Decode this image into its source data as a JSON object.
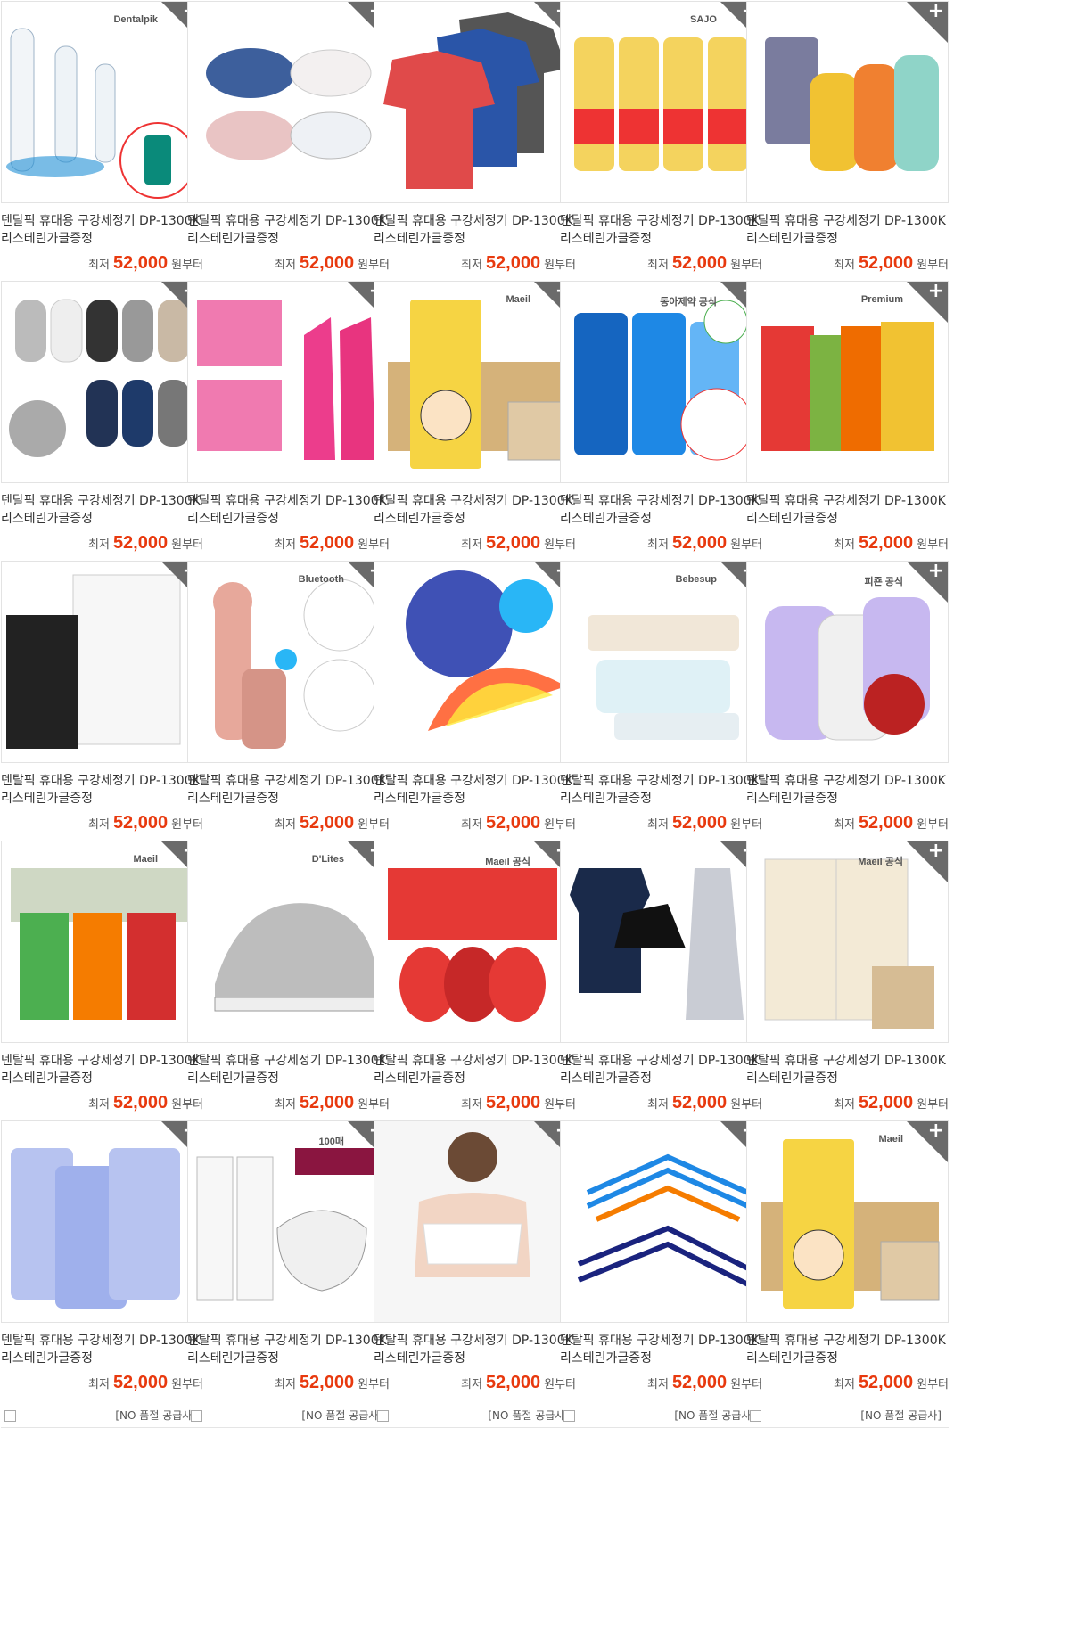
{
  "products": [
    {
      "title_line1": "덴탈픽 휴대용 구강세정기 DP-1300K",
      "title_line2": "리스테린가글증정",
      "price_prefix": "최저",
      "price": "52,000",
      "price_suffix": "원부터",
      "supplier": "[NO 품절 공급사]",
      "icon": "water-flosser-image",
      "badge": "Dentalpik",
      "add_label": "+"
    },
    {
      "title_line1": "덴탈픽 휴대용 구강세정기 DP-1300K",
      "title_line2": "리스테린가글증정",
      "price_prefix": "최저",
      "price": "52,000",
      "price_suffix": "원부터",
      "supplier": "[NO 품절 공급사]",
      "icon": "kids-shoes-image",
      "badge": "",
      "add_label": "+"
    },
    {
      "title_line1": "덴탈픽 휴대용 구강세정기 DP-1300K",
      "title_line2": "리스테린가글증정",
      "price_prefix": "최저",
      "price": "52,000",
      "price_suffix": "원부터",
      "supplier": "[NO 품절 공급사]",
      "icon": "tshirts-image",
      "badge": "",
      "add_label": "+"
    },
    {
      "title_line1": "덴탈픽 휴대용 구강세정기 DP-1300K",
      "title_line2": "리스테린가글증정",
      "price_prefix": "최저",
      "price": "52,000",
      "price_suffix": "원부터",
      "supplier": "[NO 품절 공급사]",
      "icon": "cooking-oil-image",
      "badge": "SAJO",
      "add_label": "+"
    },
    {
      "title_line1": "덴탈픽 휴대용 구강세정기 DP-1300K",
      "title_line2": "리스테린가글증정",
      "price_prefix": "최저",
      "price": "52,000",
      "price_suffix": "원부터",
      "supplier": "[NO 품절 공급사]",
      "icon": "detergent-image",
      "badge": "",
      "add_label": "+"
    },
    {
      "title_line1": "덴탈픽 휴대용 구강세정기 DP-1300K",
      "title_line2": "리스테린가글증정",
      "price_prefix": "최저",
      "price": "52,000",
      "price_suffix": "원부터",
      "supplier": "[NO 품절 공급사]",
      "icon": "socks-image",
      "badge": "",
      "add_label": "+"
    },
    {
      "title_line1": "덴탈픽 휴대용 구강세정기 DP-1300K",
      "title_line2": "리스테린가글증정",
      "price_prefix": "최저",
      "price": "52,000",
      "price_suffix": "원부터",
      "supplier": "[NO 품절 공급사]",
      "icon": "rubber-gloves-image",
      "badge": "",
      "add_label": "+"
    },
    {
      "title_line1": "덴탈픽 휴대용 구강세정기 DP-1300K",
      "title_line2": "리스테린가글증정",
      "price_prefix": "최저",
      "price": "52,000",
      "price_suffix": "원부터",
      "supplier": "[NO 품절 공급사]",
      "icon": "banana-milk-image",
      "badge": "Maeil",
      "add_label": "+"
    },
    {
      "title_line1": "덴탈픽 휴대용 구강세정기 DP-1300K",
      "title_line2": "리스테린가글증정",
      "price_prefix": "최저",
      "price": "52,000",
      "price_suffix": "원부터",
      "supplier": "[NO 품절 공급사]",
      "icon": "mouthwash-image",
      "badge": "동아제약 공식",
      "add_label": "+"
    },
    {
      "title_line1": "덴탈픽 휴대용 구강세정기 DP-1300K",
      "title_line2": "리스테린가글증정",
      "price_prefix": "최저",
      "price": "52,000",
      "price_suffix": "원부터",
      "supplier": "[NO 품절 공급사]",
      "icon": "supplement-pouch-image",
      "badge": "Premium",
      "add_label": "+"
    },
    {
      "title_line1": "덴탈픽 휴대용 구강세정기 DP-1300K",
      "title_line2": "리스테린가글증정",
      "price_prefix": "최저",
      "price": "52,000",
      "price_suffix": "원부터",
      "supplier": "[NO 품절 공급사]",
      "icon": "air-purifier-image",
      "badge": "",
      "add_label": "+"
    },
    {
      "title_line1": "덴탈픽 휴대용 구강세정기 DP-1300K",
      "title_line2": "리스테린가글증정",
      "price_prefix": "최저",
      "price": "52,000",
      "price_suffix": "원부터",
      "supplier": "[NO 품절 공급사]",
      "icon": "karaoke-mic-image",
      "badge": "Bluetooth",
      "add_label": "+"
    },
    {
      "title_line1": "덴탈픽 휴대용 구강세정기 DP-1300K",
      "title_line2": "리스테린가글증정",
      "price_prefix": "최저",
      "price": "52,000",
      "price_suffix": "원부터",
      "supplier": "[NO 품절 공급사]",
      "icon": "umbrella-image",
      "badge": "",
      "add_label": "+"
    },
    {
      "title_line1": "덴탈픽 휴대용 구강세정기 DP-1300K",
      "title_line2": "리스테린가글증정",
      "price_prefix": "최저",
      "price": "52,000",
      "price_suffix": "원부터",
      "supplier": "[NO 품절 공급사]",
      "icon": "wet-wipes-image",
      "badge": "Bebesup",
      "add_label": "+"
    },
    {
      "title_line1": "덴탈픽 휴대용 구강세정기 DP-1300K",
      "title_line2": "리스테린가글증정",
      "price_prefix": "최저",
      "price": "52,000",
      "price_suffix": "원부터",
      "supplier": "[NO 품절 공급사]",
      "icon": "fabric-softener-image",
      "badge": "피죤 공식",
      "add_label": "+"
    },
    {
      "title_line1": "덴탈픽 휴대용 구강세정기 DP-1300K",
      "title_line2": "리스테린가글증정",
      "price_prefix": "최저",
      "price": "52,000",
      "price_suffix": "원부터",
      "supplier": "[NO 품절 공급사]",
      "icon": "juice-box-image",
      "badge": "Maeil",
      "add_label": "+"
    },
    {
      "title_line1": "덴탈픽 휴대용 구강세정기 DP-1300K",
      "title_line2": "리스테린가글증정",
      "price_prefix": "최저",
      "price": "52,000",
      "price_suffix": "원부터",
      "supplier": "[NO 품절 공급사]",
      "icon": "sneakers-image",
      "badge": "D'Lites",
      "add_label": "+"
    },
    {
      "title_line1": "덴탈픽 휴대용 구강세정기 DP-1300K",
      "title_line2": "리스테린가글증정",
      "price_prefix": "최저",
      "price": "52,000",
      "price_suffix": "원부터",
      "supplier": "[NO 품절 공급사]",
      "icon": "chocolate-egg-image",
      "badge": "Maeil 공식",
      "add_label": "+"
    },
    {
      "title_line1": "덴탈픽 휴대용 구강세정기 DP-1300K",
      "title_line2": "리스테린가글증정",
      "price_prefix": "최저",
      "price": "52,000",
      "price_suffix": "원부터",
      "supplier": "[NO 품절 공급사]",
      "icon": "dress-image",
      "badge": "",
      "add_label": "+"
    },
    {
      "title_line1": "덴탈픽 휴대용 구강세정기 DP-1300K",
      "title_line2": "리스테린가글증정",
      "price_prefix": "최저",
      "price": "52,000",
      "price_suffix": "원부터",
      "supplier": "[NO 품절 공급사]",
      "icon": "milk-carton-image",
      "badge": "Maeil 공식",
      "add_label": "+"
    },
    {
      "title_line1": "덴탈픽 휴대용 구강세정기 DP-1300K",
      "title_line2": "리스테린가글증정",
      "price_prefix": "최저",
      "price": "52,000",
      "price_suffix": "원부터",
      "supplier": "[NO 품절 공급사]",
      "icon": "toilet-paper-image",
      "badge": "",
      "add_label": "+"
    },
    {
      "title_line1": "덴탈픽 휴대용 구강세정기 DP-1300K",
      "title_line2": "리스테린가글증정",
      "price_prefix": "최저",
      "price": "52,000",
      "price_suffix": "원부터",
      "supplier": "[NO 품절 공급사]",
      "icon": "face-mask-image",
      "badge": "100매",
      "add_label": "+"
    },
    {
      "title_line1": "덴탈픽 휴대용 구강세정기 DP-1300K",
      "title_line2": "리스테린가글증정",
      "price_prefix": "최저",
      "price": "52,000",
      "price_suffix": "원부터",
      "supplier": "[NO 품절 공급사]",
      "icon": "sports-bra-image",
      "badge": "",
      "add_label": "+"
    },
    {
      "title_line1": "덴탈픽 휴대용 구강세정기 DP-1300K",
      "title_line2": "리스테린가글증정",
      "price_prefix": "최저",
      "price": "52,000",
      "price_suffix": "원부터",
      "supplier": "[NO 품절 공급사]",
      "icon": "hangers-image",
      "badge": "",
      "add_label": "+"
    },
    {
      "title_line1": "덴탈픽 휴대용 구강세정기 DP-1300K",
      "title_line2": "리스테린가글증정",
      "price_prefix": "최저",
      "price": "52,000",
      "price_suffix": "원부터",
      "supplier": "[NO 품절 공급사]",
      "icon": "banana-milk-image",
      "badge": "Maeil",
      "add_label": "+"
    }
  ],
  "colors": {
    "price": "#e8390e",
    "corner": "#6b6b6b",
    "border": "#e3e3e3"
  }
}
